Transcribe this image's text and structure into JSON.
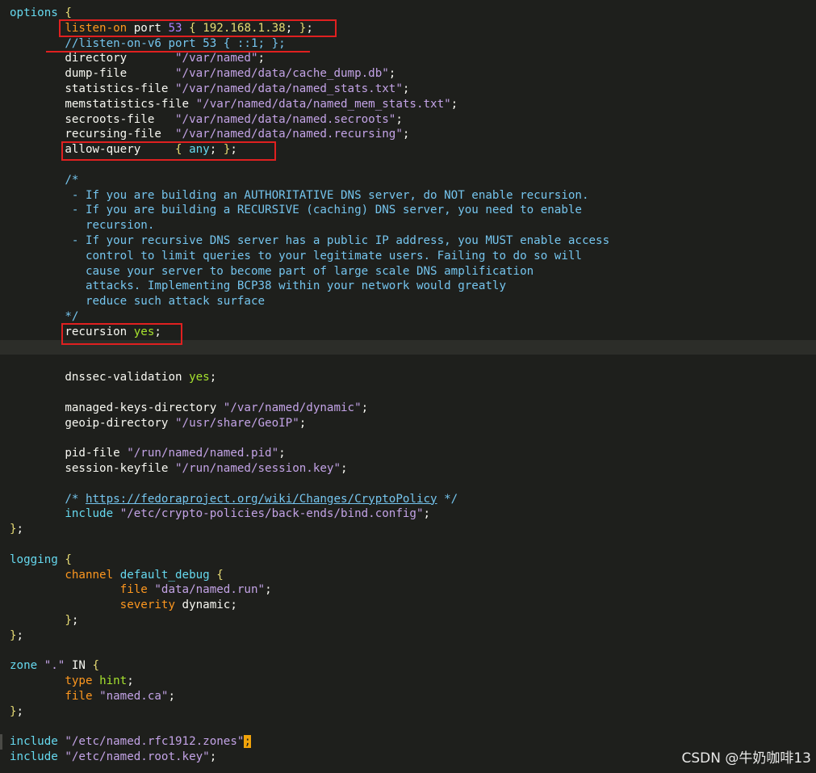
{
  "editor": {
    "lines": [
      [
        [
          "kw",
          "options"
        ],
        [
          "punc",
          " "
        ],
        [
          "brace",
          "{"
        ]
      ],
      [
        [
          "punc",
          "        "
        ],
        [
          "prop",
          "listen-on"
        ],
        [
          "punc",
          " port "
        ],
        [
          "num",
          "53"
        ],
        [
          "punc",
          " "
        ],
        [
          "brace",
          "{"
        ],
        [
          "punc",
          " "
        ],
        [
          "brace",
          "192.168.1.38"
        ],
        [
          "punc",
          "; "
        ],
        [
          "brace",
          "}"
        ],
        [
          "punc",
          ";"
        ]
      ],
      [
        [
          "punc",
          "        "
        ],
        [
          "cm",
          "//listen-on-v6 port 53 { ::1; };"
        ]
      ],
      [
        [
          "punc",
          "        directory       "
        ],
        [
          "str",
          "\"/var/named\""
        ],
        [
          "punc",
          ";"
        ]
      ],
      [
        [
          "punc",
          "        dump-file       "
        ],
        [
          "str",
          "\"/var/named/data/cache_dump.db\""
        ],
        [
          "punc",
          ";"
        ]
      ],
      [
        [
          "punc",
          "        statistics-file "
        ],
        [
          "str",
          "\"/var/named/data/named_stats.txt\""
        ],
        [
          "punc",
          ";"
        ]
      ],
      [
        [
          "punc",
          "        memstatistics-file "
        ],
        [
          "str",
          "\"/var/named/data/named_mem_stats.txt\""
        ],
        [
          "punc",
          ";"
        ]
      ],
      [
        [
          "punc",
          "        secroots-file   "
        ],
        [
          "str",
          "\"/var/named/data/named.secroots\""
        ],
        [
          "punc",
          ";"
        ]
      ],
      [
        [
          "punc",
          "        recursing-file  "
        ],
        [
          "str",
          "\"/var/named/data/named.recursing\""
        ],
        [
          "punc",
          ";"
        ]
      ],
      [
        [
          "punc",
          "        allow-query     "
        ],
        [
          "brace",
          "{"
        ],
        [
          "punc",
          " "
        ],
        [
          "kw",
          "any"
        ],
        [
          "punc",
          "; "
        ],
        [
          "brace",
          "}"
        ],
        [
          "punc",
          ";"
        ]
      ],
      [
        [
          "punc",
          ""
        ]
      ],
      [
        [
          "punc",
          "        "
        ],
        [
          "cm",
          "/*"
        ]
      ],
      [
        [
          "punc",
          "        "
        ],
        [
          "cm",
          " - If you are building an AUTHORITATIVE DNS server, do NOT enable recursion."
        ]
      ],
      [
        [
          "punc",
          "        "
        ],
        [
          "cm",
          " - If you are building a RECURSIVE (caching) DNS server, you need to enable"
        ]
      ],
      [
        [
          "punc",
          "        "
        ],
        [
          "cm",
          "   recursion."
        ]
      ],
      [
        [
          "punc",
          "        "
        ],
        [
          "cm",
          " - If your recursive DNS server has a public IP address, you MUST enable access"
        ]
      ],
      [
        [
          "punc",
          "        "
        ],
        [
          "cm",
          "   control to limit queries to your legitimate users. Failing to do so will"
        ]
      ],
      [
        [
          "punc",
          "        "
        ],
        [
          "cm",
          "   cause your server to become part of large scale DNS amplification"
        ]
      ],
      [
        [
          "punc",
          "        "
        ],
        [
          "cm",
          "   attacks. Implementing BCP38 within your network would greatly"
        ]
      ],
      [
        [
          "punc",
          "        "
        ],
        [
          "cm",
          "   reduce such attack surface"
        ]
      ],
      [
        [
          "punc",
          "        "
        ],
        [
          "cm",
          "*/"
        ]
      ],
      [
        [
          "punc",
          "        recursion "
        ],
        [
          "green",
          "yes"
        ],
        [
          "punc",
          ";"
        ]
      ],
      [
        [
          "punc",
          ""
        ]
      ],
      [
        [
          "punc",
          ""
        ]
      ],
      [
        [
          "punc",
          "        dnssec-validation "
        ],
        [
          "green",
          "yes"
        ],
        [
          "punc",
          ";"
        ]
      ],
      [
        [
          "punc",
          ""
        ]
      ],
      [
        [
          "punc",
          "        managed-keys-directory "
        ],
        [
          "str",
          "\"/var/named/dynamic\""
        ],
        [
          "punc",
          ";"
        ]
      ],
      [
        [
          "punc",
          "        geoip-directory "
        ],
        [
          "str",
          "\"/usr/share/GeoIP\""
        ],
        [
          "punc",
          ";"
        ]
      ],
      [
        [
          "punc",
          ""
        ]
      ],
      [
        [
          "punc",
          "        pid-file "
        ],
        [
          "str",
          "\"/run/named/named.pid\""
        ],
        [
          "punc",
          ";"
        ]
      ],
      [
        [
          "punc",
          "        session-keyfile "
        ],
        [
          "str",
          "\"/run/named/session.key\""
        ],
        [
          "punc",
          ";"
        ]
      ],
      [
        [
          "punc",
          ""
        ]
      ],
      [
        [
          "punc",
          "        "
        ],
        [
          "cm",
          "/* "
        ],
        [
          "link",
          "https://fedoraproject.org/wiki/Changes/CryptoPolicy"
        ],
        [
          "cm",
          " */"
        ]
      ],
      [
        [
          "punc",
          "        "
        ],
        [
          "kw",
          "include"
        ],
        [
          "punc",
          " "
        ],
        [
          "str",
          "\"/etc/crypto-policies/back-ends/bind.config\""
        ],
        [
          "punc",
          ";"
        ]
      ],
      [
        [
          "brace",
          "}"
        ],
        [
          "punc",
          ";"
        ]
      ],
      [
        [
          "punc",
          ""
        ]
      ],
      [
        [
          "kw",
          "logging"
        ],
        [
          "punc",
          " "
        ],
        [
          "brace",
          "{"
        ]
      ],
      [
        [
          "punc",
          "        "
        ],
        [
          "prop",
          "channel"
        ],
        [
          "punc",
          " "
        ],
        [
          "kw",
          "default_debug"
        ],
        [
          "punc",
          " "
        ],
        [
          "brace",
          "{"
        ]
      ],
      [
        [
          "punc",
          "                "
        ],
        [
          "prop",
          "file"
        ],
        [
          "punc",
          " "
        ],
        [
          "str",
          "\"data/named.run\""
        ],
        [
          "punc",
          ";"
        ]
      ],
      [
        [
          "punc",
          "                "
        ],
        [
          "prop",
          "severity"
        ],
        [
          "punc",
          " dynamic;"
        ]
      ],
      [
        [
          "punc",
          "        "
        ],
        [
          "brace",
          "}"
        ],
        [
          "punc",
          ";"
        ]
      ],
      [
        [
          "brace",
          "}"
        ],
        [
          "punc",
          ";"
        ]
      ],
      [
        [
          "punc",
          ""
        ]
      ],
      [
        [
          "kw",
          "zone"
        ],
        [
          "punc",
          " "
        ],
        [
          "str",
          "\".\""
        ],
        [
          "punc",
          " IN "
        ],
        [
          "brace",
          "{"
        ]
      ],
      [
        [
          "punc",
          "        "
        ],
        [
          "prop",
          "type"
        ],
        [
          "punc",
          " "
        ],
        [
          "green",
          "hint"
        ],
        [
          "punc",
          ";"
        ]
      ],
      [
        [
          "punc",
          "        "
        ],
        [
          "prop",
          "file"
        ],
        [
          "punc",
          " "
        ],
        [
          "str",
          "\"named.ca\""
        ],
        [
          "punc",
          ";"
        ]
      ],
      [
        [
          "brace",
          "}"
        ],
        [
          "punc",
          ";"
        ]
      ],
      [
        [
          "punc",
          ""
        ]
      ],
      [
        [
          "kw",
          "include"
        ],
        [
          "punc",
          " "
        ],
        [
          "str",
          "\"/etc/named.rfc1912.zones\""
        ],
        [
          "cursor",
          ";"
        ]
      ],
      [
        [
          "kw",
          "include"
        ],
        [
          "punc",
          " "
        ],
        [
          "str",
          "\"/etc/named.root.key\""
        ],
        [
          "punc",
          ";"
        ]
      ]
    ],
    "current_line": 22,
    "marked_line": 48
  },
  "watermark": "CSDN @牛奶咖啡13",
  "colors": {
    "background": "#1e1f1c",
    "highlight_box": "#e02020",
    "cursor": "#f0a30a"
  }
}
